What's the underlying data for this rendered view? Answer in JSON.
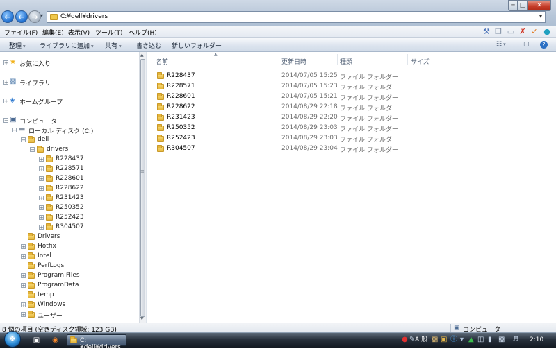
{
  "window": {
    "address": "C:¥dell¥drivers",
    "controls": {
      "minimize": "─",
      "maximize": "□",
      "close": "✕"
    }
  },
  "menu": [
    "ファイル(F)",
    "編集(E)",
    "表示(V)",
    "ツール(T)",
    "ヘルプ(H)"
  ],
  "toolbar": {
    "organize": "整理",
    "add_to_library": "ライブラリに追加",
    "share": "共有",
    "burn": "書き込む",
    "new_folder": "新しいフォルダー"
  },
  "nav": {
    "favorites": "お気に入り",
    "libraries": "ライブラリ",
    "homegroup": "ホームグループ",
    "computer": "コンピューター",
    "local_disk": "ローカル ディスク (C:)",
    "dell": "dell",
    "drivers": "drivers",
    "driver_children": [
      "R228437",
      "R228571",
      "R228601",
      "R228622",
      "R231423",
      "R250352",
      "R252423",
      "R304507"
    ],
    "c_children": [
      "Drivers",
      "Hotfix",
      "Intel",
      "PerfLogs",
      "Program Files",
      "ProgramData",
      "temp",
      "Windows",
      "ユーザー"
    ]
  },
  "columns": {
    "name": "名前",
    "date": "更新日時",
    "type": "種類",
    "size": "サイズ"
  },
  "files": [
    {
      "name": "R228437",
      "date": "2014/07/05 15:25",
      "type": "ファイル フォルダー"
    },
    {
      "name": "R228571",
      "date": "2014/07/05 15:23",
      "type": "ファイル フォルダー"
    },
    {
      "name": "R228601",
      "date": "2014/07/05 15:21",
      "type": "ファイル フォルダー"
    },
    {
      "name": "R228622",
      "date": "2014/08/29 22:18",
      "type": "ファイル フォルダー"
    },
    {
      "name": "R231423",
      "date": "2014/08/29 22:20",
      "type": "ファイル フォルダー"
    },
    {
      "name": "R250352",
      "date": "2014/08/29 23:03",
      "type": "ファイル フォルダー"
    },
    {
      "name": "R252423",
      "date": "2014/08/29 23:03",
      "type": "ファイル フォルダー"
    },
    {
      "name": "R304507",
      "date": "2014/08/29 23:04",
      "type": "ファイル フォルダー"
    }
  ],
  "status": {
    "left": "8 個の項目 (空きディスク領域: 123 GB)",
    "right": "コンピューター"
  },
  "taskbar": {
    "window_button": "C:¥dell¥drivers",
    "ime_mode": "A 般",
    "clock": "2:10"
  },
  "colors": {
    "accent": "#1f6fd0",
    "close_red": "#c63d2a",
    "folder_yellow": "#e6b53a",
    "secondary_text": "#6d6d6d"
  }
}
